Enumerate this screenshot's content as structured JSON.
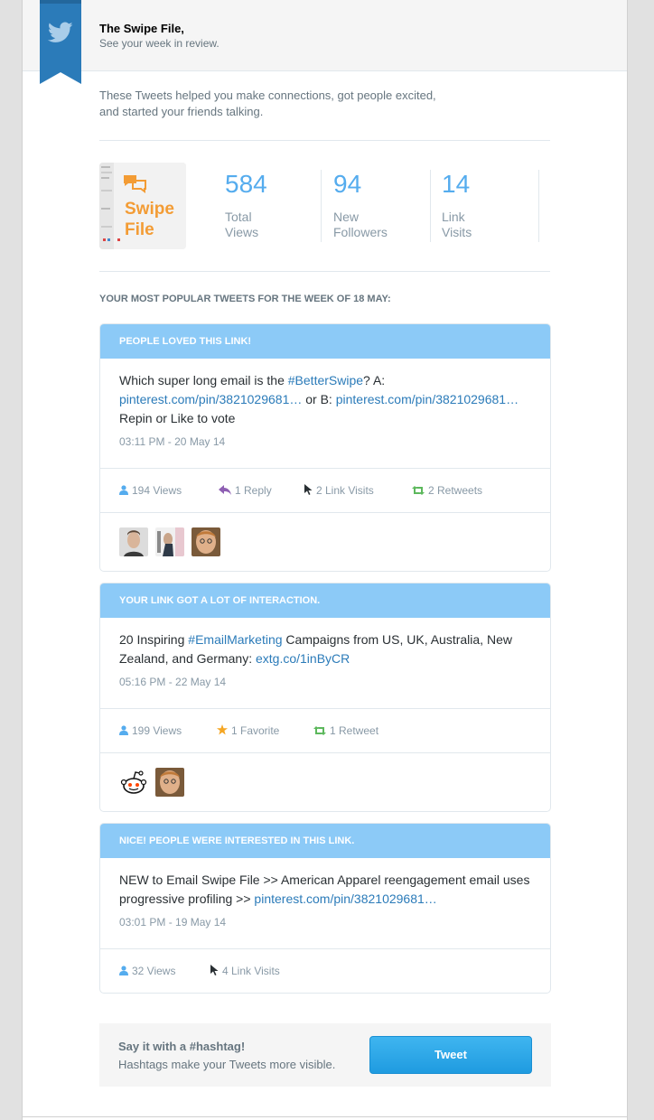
{
  "header": {
    "title": "The Swipe File,",
    "subtitle": "See your week in review.",
    "ribbon_color": "#2b7bb9"
  },
  "intro": "These Tweets helped you make connections, got people excited, and started your friends talking.",
  "thumbnail": {
    "line1": "Swipe",
    "line2": "File",
    "accent": "#f39c35"
  },
  "stats": [
    {
      "value": "584",
      "label_line1": "Total",
      "label_line2": "Views"
    },
    {
      "value": "94",
      "label_line1": "New",
      "label_line2": "Followers"
    },
    {
      "value": "14",
      "label_line1": "Link",
      "label_line2": "Visits"
    }
  ],
  "section_title": "YOUR MOST POPULAR TWEETS FOR THE WEEK OF 18 MAY:",
  "cards": [
    {
      "head": "PEOPLE LOVED THIS LINK!",
      "text_1": "Which super long email is the ",
      "hashtag": "#BetterSwipe",
      "text_2": "? A: ",
      "link_1": "pinterest.com/pin/3821029681…",
      "text_3": " or B: ",
      "link_2": "pinterest.com/pin/3821029681…",
      "text_4": " Repin or Like to vote",
      "date": "03:11 PM - 20 May 14",
      "metrics": {
        "views": "194 Views",
        "replies": "1 Reply",
        "link_visits": "2 Link Visits",
        "retweets": "2 Retweets"
      }
    },
    {
      "head": "YOUR LINK GOT A LOT OF INTERACTION.",
      "text_1": "20 Inspiring ",
      "hashtag": "#EmailMarketing",
      "text_2": " Campaigns from US, UK, Australia, New Zealand, and Germany: ",
      "link_1": "extg.co/1inByCR",
      "date": "05:16 PM - 22 May 14",
      "metrics": {
        "views": "199 Views",
        "favorites": "1 Favorite",
        "retweets": "1 Retweet"
      }
    },
    {
      "head": "NICE! PEOPLE WERE INTERESTED IN THIS LINK.",
      "text_1": "NEW to Email Swipe File >> American Apparel reengagement email uses progressive profiling >> ",
      "link_1": "pinterest.com/pin/3821029681…",
      "date": "03:01 PM - 19 May 14",
      "metrics": {
        "views": "32 Views",
        "link_visits": "4 Link Visits"
      }
    }
  ],
  "cta": {
    "title": "Say it with a #hashtag!",
    "subtitle": "Hashtags make your Tweets more visible.",
    "button": "Tweet"
  },
  "colors": {
    "accent": "#55acee",
    "card_header": "#8ccaf7",
    "link": "#2b7bb9",
    "reply_icon": "#8e5fb3",
    "retweet_icon": "#5cb85c",
    "favorite_icon": "#f5a623"
  }
}
